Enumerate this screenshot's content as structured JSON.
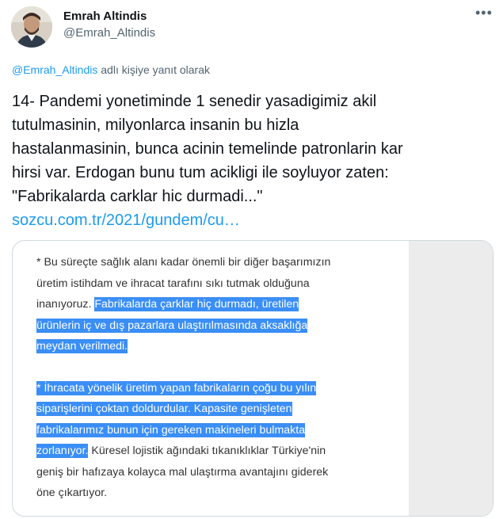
{
  "author": {
    "name": "Emrah Altindis",
    "handle": "@Emrah_Altindis",
    "avatar_icon": "avatar-icon"
  },
  "more_icon": "more-options-icon",
  "reply_to": {
    "mention": "@Emrah_Altindis",
    "suffix": " adlı kişiye yanıt olarak"
  },
  "tweet": {
    "lines": [
      "14- Pandemi yonetiminde 1 senedir yasadigimiz akil",
      "tutulmasinin,  milyonlarca insanin bu hizla",
      "hastalanmasinin, bunca acinin temelinde patronlarin kar",
      "hirsi var. Erdogan bunu tum acikligi ile soyluyor zaten:",
      "\"Fabrikalarda carklar hic durmadi...\""
    ],
    "link": "sozcu.com.tr/2021/gundem/cu…"
  },
  "image": {
    "p1_l1": "* Bu süreçte sağlık alanı kadar önemli bir diğer başarımızın",
    "p1_l2": "üretim istihdam ve ihracat tarafını sıkı tutmak olduğuna",
    "p1_l3_plain": "inanıyoruz. ",
    "p1_l3_hl": "Fabrikalarda çarklar hiç durmadı, üretilen",
    "p1_l4_hl": "ürünlerin iç ve dış pazarlara ulaştırılmasında aksaklığa",
    "p1_l5_hl": "meydan verilmedi.",
    "p2_l1_hl": "* İhracata yönelik üretim yapan fabrikaların çoğu bu yılın",
    "p2_l2_hl": "siparişlerini çoktan doldurdular. Kapasite genişleten",
    "p2_l3_hl": "fabrikalarımız bunun için gereken makineleri bulmakta",
    "p2_l4_hl": "zorlanıyor.",
    "p2_l4_plain": " Küresel lojistik ağındaki tıkanıklıklar Türkiye'nin",
    "p2_l5": "geniş bir hafızaya kolayca mal ulaştırma avantajını giderek",
    "p2_l6": "öne çıkartıyor."
  },
  "colors": {
    "accent": "#1d9bf0",
    "highlight": "#3a8ef6",
    "muted": "#536471"
  }
}
